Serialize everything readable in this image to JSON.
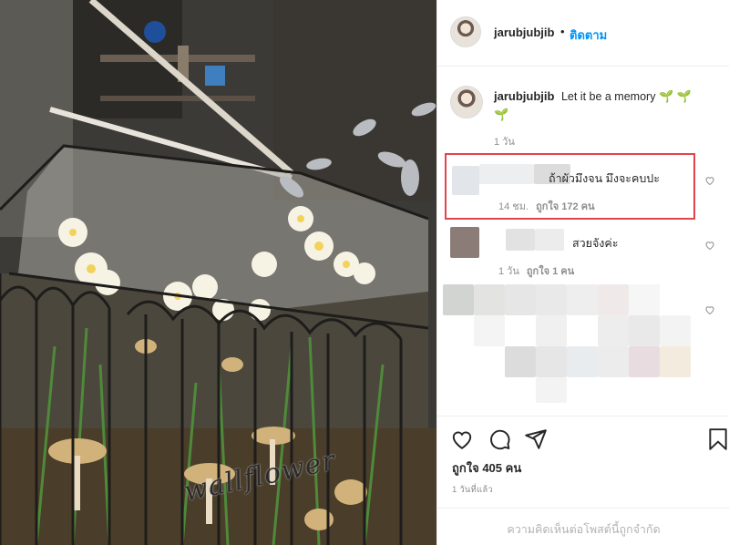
{
  "post": {
    "author": "jarubjubjib",
    "header_dot": "•",
    "follow_label": "ติดตาม",
    "caption": "Let it be a memory",
    "caption_emoji": [
      "🌱",
      "🌱",
      "🌱"
    ],
    "caption_time": "1 วัน",
    "photo_overlay_text": "wallflower"
  },
  "comments": [
    {
      "text": "ถ้าผัวมึงจน มึงจะคบปะ",
      "time": "14 ชม.",
      "likes": "ถูกใจ 172 คน",
      "highlighted": true
    },
    {
      "text": "สวยจังค่ะ",
      "time": "1 วัน",
      "likes": "ถูกใจ 1 คน",
      "highlighted": false
    },
    {
      "text": "",
      "time": "",
      "likes": "",
      "highlighted": false
    }
  ],
  "actions": {
    "like_count": "ถูกใจ 405 คน",
    "post_time": "1 วันที่แล้ว",
    "comments_disabled_note": "ความคิดเห็นต่อโพสต์นี้ถูกจำกัด"
  },
  "colors": {
    "link_blue": "#0095f6",
    "highlight_red": "#e0454b",
    "muted_text": "#8e8e8e"
  },
  "icons": [
    "heart-icon",
    "comment-icon",
    "share-icon",
    "bookmark-icon",
    "comment-like-icon"
  ]
}
